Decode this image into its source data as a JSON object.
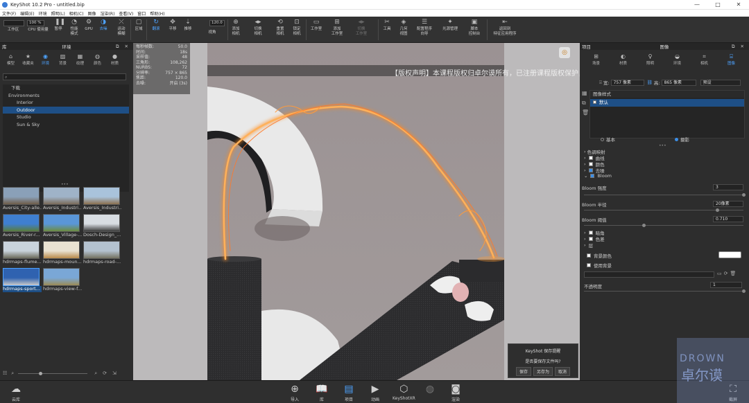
{
  "window": {
    "title": "KeyShot 10.2 Pro  -  untitled.bip",
    "minimize": "—",
    "maximize": "□",
    "close": "✕"
  },
  "menu": [
    "文件(F)",
    "编辑(E)",
    "环境",
    "照明(L)",
    "相机(C)",
    "图像",
    "渲染(R)",
    "查看(V)",
    "窗口",
    "帮助(H)"
  ],
  "toolbar": {
    "zoom_value": "100 %",
    "dropdown_value": "",
    "buttons": [
      {
        "label": "工作区",
        "icon": "workspace-icon"
      },
      {
        "label": "CPU 使用量",
        "icon": "cpu-icon"
      },
      {
        "label": "暂停",
        "icon": "pause-icon"
      },
      {
        "label": "性能\n模式",
        "icon": "performance-icon"
      },
      {
        "label": "GPU",
        "icon": "gpu-icon"
      },
      {
        "label": "去噪",
        "icon": "denoise-icon"
      },
      {
        "label": "运动\n模糊",
        "icon": "motion-blur-icon"
      },
      {
        "label": "区域",
        "icon": "region-icon"
      },
      {
        "label": "翻滚",
        "icon": "tumble-icon"
      },
      {
        "label": "平移",
        "icon": "pan-icon"
      },
      {
        "label": "推移",
        "icon": "dolly-icon"
      },
      {
        "label": "视角",
        "icon": "perspective-icon"
      },
      {
        "label": "添加\n相机",
        "icon": "add-camera-icon"
      },
      {
        "label": "切换\n相机",
        "icon": "switch-camera-icon"
      },
      {
        "label": "重置\n相机",
        "icon": "reset-camera-icon"
      },
      {
        "label": "锁定\n相机",
        "icon": "lock-camera-icon"
      },
      {
        "label": "工作室",
        "icon": "studio-icon"
      },
      {
        "label": "添加\n工作室",
        "icon": "add-studio-icon"
      },
      {
        "label": "切换\n工作室",
        "icon": "switch-studio-icon"
      },
      {
        "label": "工具",
        "icon": "tools-icon"
      },
      {
        "label": "几何\n视图",
        "icon": "geometry-view-icon"
      },
      {
        "label": "配置程序\n向导",
        "icon": "configurator-icon"
      },
      {
        "label": "光源管理",
        "icon": "light-manager-icon"
      },
      {
        "label": "脚本\n控制台",
        "icon": "script-console-icon"
      },
      {
        "label": "返回到\n特征应用程序",
        "icon": "return-icon"
      }
    ],
    "fov_value": "120.0"
  },
  "left_panel": {
    "header_left": "库",
    "header_title": "环境",
    "tabs": [
      {
        "label": "模型",
        "icon": "model-icon"
      },
      {
        "label": "收藏夹",
        "icon": "favorites-icon"
      },
      {
        "label": "环境",
        "icon": "environment-icon"
      },
      {
        "label": "背景",
        "icon": "background-icon"
      },
      {
        "label": "纹理",
        "icon": "texture-icon"
      },
      {
        "label": "颜色",
        "icon": "color-icon"
      },
      {
        "label": "材质",
        "icon": "material-icon"
      }
    ],
    "tree": [
      "下载",
      "Environments",
      "Interior",
      "Outdoor",
      "Studio",
      "Sun & Sky"
    ],
    "thumbnails": [
      {
        "label": "Aversis_City-alle...",
        "colors": [
          "#8aa0b8",
          "#6e5c48"
        ]
      },
      {
        "label": "Aversis_Industri...",
        "colors": [
          "#9fb3c8",
          "#7a6a58"
        ]
      },
      {
        "label": "Aversis_Industri...",
        "colors": [
          "#a9c3db",
          "#8b6f4e"
        ]
      },
      {
        "label": "Aversis_River-r...",
        "colors": [
          "#3f7fd0",
          "#5a7c3a"
        ]
      },
      {
        "label": "Aversis_Village-...",
        "colors": [
          "#5a96d8",
          "#6d8c3f"
        ]
      },
      {
        "label": "Dosch-Design_...",
        "colors": [
          "#d8dde2",
          "#3a3a3a"
        ]
      },
      {
        "label": "hdrmaps-flume...",
        "colors": [
          "#c9d3dc",
          "#6a6a5a"
        ]
      },
      {
        "label": "hdrmaps-moun...",
        "colors": [
          "#e9e2d2",
          "#b88a4a"
        ]
      },
      {
        "label": "hdrmaps-road-...",
        "colors": [
          "#b4c2cf",
          "#73705f"
        ]
      },
      {
        "label": "hdrmaps-sport...",
        "colors": [
          "#2f62b0",
          "#c9c9c9"
        ]
      },
      {
        "label": "hdrmaps-view-f...",
        "colors": [
          "#7aa7d6",
          "#9c8b55"
        ]
      }
    ]
  },
  "hud": {
    "rows": [
      {
        "k": "每秒帧数:",
        "v": "50.0"
      },
      {
        "k": "时间:",
        "v": "18s"
      },
      {
        "k": "采样值:",
        "v": "48"
      },
      {
        "k": "三角形:",
        "v": "108,262"
      },
      {
        "k": "NURBS:",
        "v": "72"
      },
      {
        "k": "分辨率:",
        "v": "757 × 865"
      },
      {
        "k": "焦距:",
        "v": "120.0"
      },
      {
        "k": "去噪:",
        "v": "开启 (3s)"
      }
    ]
  },
  "watermark": "【版权声明】本课程版权归卓尔谟所有，已注册课程版权保护，盗版必究!",
  "save_dialog": {
    "title": "KeyShot 保存提醒",
    "message": "是否要保存文件吗?",
    "save": "保存",
    "save_as": "另存为",
    "cancel": "取消"
  },
  "right_panel": {
    "header_left": "项目",
    "header_title": "图像",
    "tabs": [
      {
        "label": "场景",
        "icon": "scene-icon"
      },
      {
        "label": "材质",
        "icon": "material-icon"
      },
      {
        "label": "照明",
        "icon": "lighting-icon"
      },
      {
        "label": "环境",
        "icon": "environment-icon"
      },
      {
        "label": "相机",
        "icon": "camera-icon"
      },
      {
        "label": "图像",
        "icon": "image-icon"
      }
    ],
    "width_label": "宽:",
    "width_value": "757 像素",
    "height_label": "高:",
    "height_value": "865 像素",
    "preset_value": "预设",
    "image_styles_header": "图像样式",
    "style_selected": "默认",
    "mode_basic": "基本",
    "mode_photographic": "摄影",
    "sections": [
      {
        "label": "色调映射",
        "checkbox": false,
        "checked": false
      },
      {
        "label": "曲线",
        "checkbox": true,
        "checked": false
      },
      {
        "label": "颜色",
        "checkbox": true,
        "checked": false
      },
      {
        "label": "去噪",
        "checkbox": true,
        "checked": true
      },
      {
        "label": "Bloom",
        "checkbox": true,
        "checked": true
      }
    ],
    "bloom_strength_label": "Bloom 强度",
    "bloom_strength_value": "3",
    "bloom_radius_label": "Bloom 半径",
    "bloom_radius_value": "20像素",
    "bloom_threshold_label": "Bloom 阈值",
    "bloom_threshold_value": "0.710",
    "sections2": [
      {
        "label": "暗角",
        "checked": false
      },
      {
        "label": "色差",
        "checked": false
      }
    ],
    "layer_label": "层",
    "bg_color_label": "背景颜色",
    "bg_color_value": "#ffffff",
    "use_bg_label": "使用背景",
    "opacity_label": "不透明度",
    "opacity_value": "1"
  },
  "status_bar": {
    "cloud": "云库",
    "buttons": [
      {
        "label": "导入",
        "icon": "import-icon"
      },
      {
        "label": "库",
        "icon": "library-icon"
      },
      {
        "label": "项目",
        "icon": "project-icon"
      },
      {
        "label": "动画",
        "icon": "animation-icon"
      },
      {
        "label": "KeyShotXR",
        "icon": "keyshotxr-icon"
      },
      {
        "label": "渲染",
        "icon": "render-icon"
      }
    ],
    "screenshot": "截屏"
  },
  "logo": {
    "text_top": "DROWN",
    "text_bottom": "卓尔谟"
  }
}
